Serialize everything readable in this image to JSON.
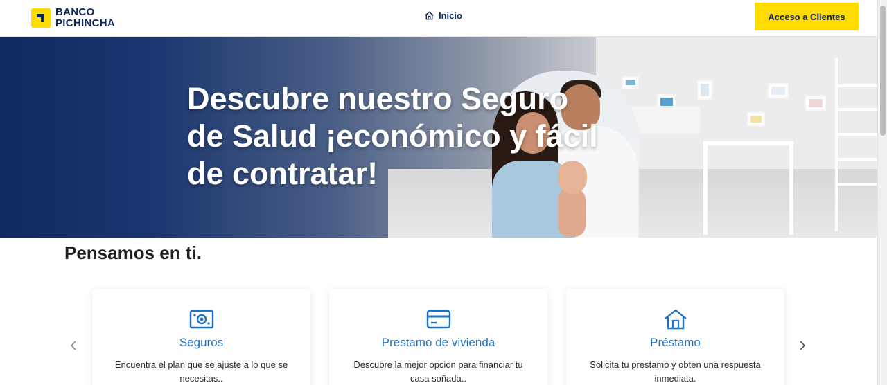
{
  "header": {
    "logo_line1": "BANCO",
    "logo_line2": "PICHINCHA",
    "nav_home_label": "Inicio",
    "nav_home_icon": "home-icon",
    "access_button": "Acceso a Clientes"
  },
  "hero": {
    "title": "Descubre nuestro Seguro de Salud ¡económico y fácil de contratar!"
  },
  "section": {
    "title": "Pensamos en ti."
  },
  "cards": [
    {
      "icon": "money-bill-icon",
      "title": "Seguros",
      "description": "Encuentra el plan que se ajuste a lo que se necesitas.."
    },
    {
      "icon": "credit-card-icon",
      "title": "Prestamo de vivienda",
      "description": "Descubre la mejor opcion para financiar tu casa soñada.."
    },
    {
      "icon": "house-icon",
      "title": "Préstamo",
      "description": "Solicita tu prestamo y obten una respuesta inmediata."
    }
  ],
  "carousel": {
    "prev_icon": "chevron-left-icon",
    "next_icon": "chevron-right-icon"
  },
  "colors": {
    "brand_yellow": "#ffdd00",
    "brand_navy": "#0f265c",
    "link_blue": "#1a73c7"
  }
}
